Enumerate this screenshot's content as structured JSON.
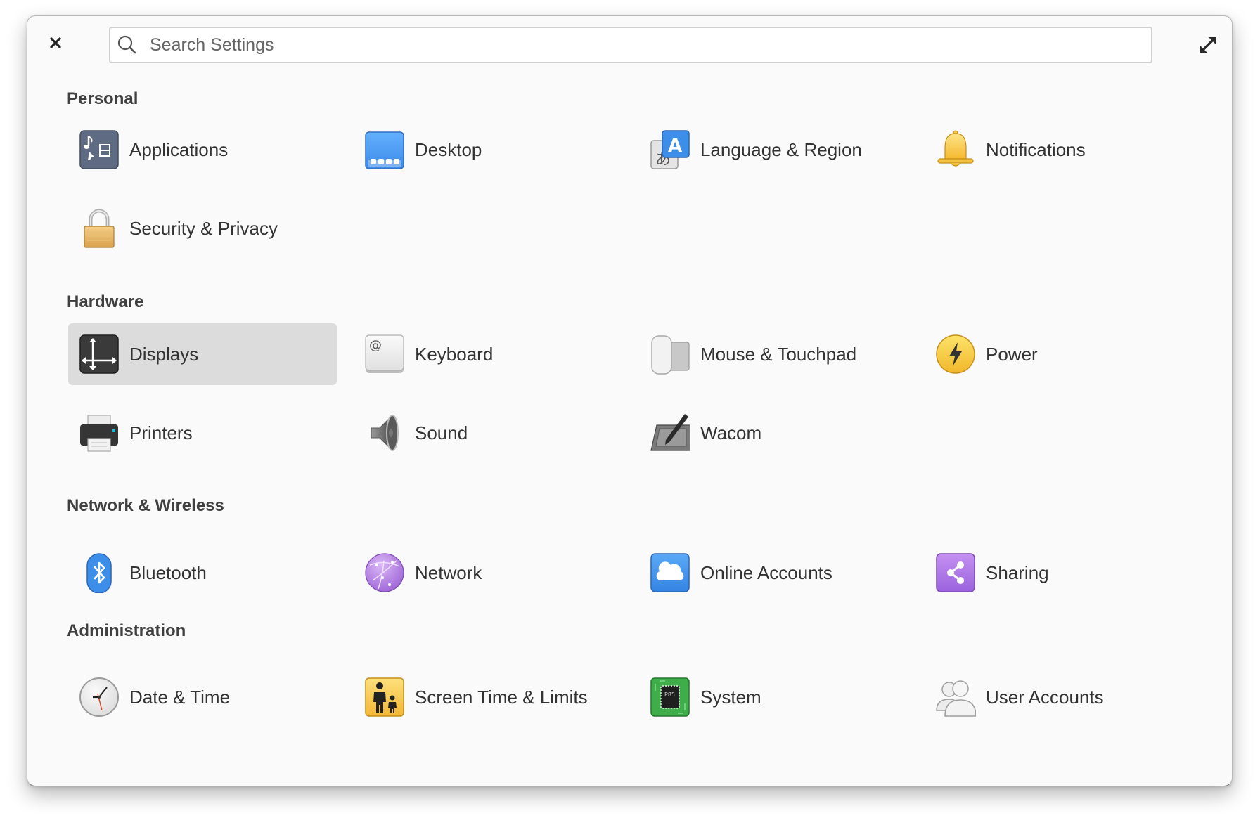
{
  "header": {
    "close_label": "Close",
    "search_placeholder": "Search Settings",
    "search_value": "",
    "maximize_label": "Maximize"
  },
  "sections": [
    {
      "title": "Personal",
      "items": [
        {
          "label": "Applications",
          "icon": "applications-icon"
        },
        {
          "label": "Desktop",
          "icon": "desktop-icon"
        },
        {
          "label": "Language & Region",
          "icon": "language-icon"
        },
        {
          "label": "Notifications",
          "icon": "bell-icon"
        },
        {
          "label": "Security & Privacy",
          "icon": "lock-icon"
        }
      ]
    },
    {
      "title": "Hardware",
      "items": [
        {
          "label": "Displays",
          "icon": "displays-icon",
          "selected": true
        },
        {
          "label": "Keyboard",
          "icon": "keyboard-icon"
        },
        {
          "label": "Mouse & Touchpad",
          "icon": "mouse-icon"
        },
        {
          "label": "Power",
          "icon": "power-icon"
        },
        {
          "label": "Printers",
          "icon": "printer-icon"
        },
        {
          "label": "Sound",
          "icon": "speaker-icon"
        },
        {
          "label": "Wacom",
          "icon": "tablet-icon"
        }
      ]
    },
    {
      "title": "Network & Wireless",
      "items": [
        {
          "label": "Bluetooth",
          "icon": "bluetooth-icon"
        },
        {
          "label": "Network",
          "icon": "globe-icon"
        },
        {
          "label": "Online Accounts",
          "icon": "cloud-icon"
        },
        {
          "label": "Sharing",
          "icon": "share-icon"
        }
      ]
    },
    {
      "title": "Administration",
      "items": [
        {
          "label": "Date & Time",
          "icon": "clock-icon"
        },
        {
          "label": "Screen Time & Limits",
          "icon": "parental-icon"
        },
        {
          "label": "System",
          "icon": "chip-icon"
        },
        {
          "label": "User Accounts",
          "icon": "users-icon"
        }
      ]
    }
  ],
  "colors": {
    "window_bg": "#fafafa",
    "selected_bg": "#dcdcdc",
    "text": "#333333",
    "section_text": "#404040"
  }
}
